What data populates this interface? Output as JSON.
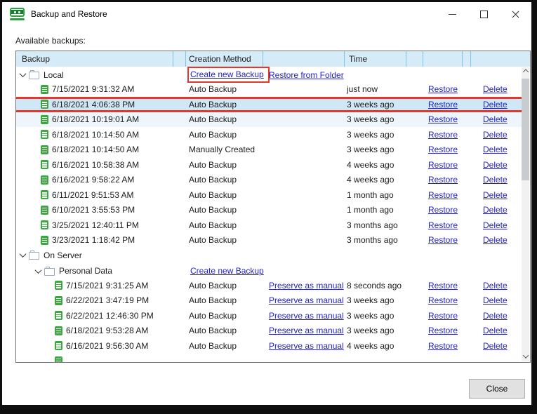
{
  "window": {
    "title": "Backup and Restore",
    "controls": {
      "minimize": "minimize",
      "maximize": "maximize",
      "close": "close"
    }
  },
  "label_available": "Available backups:",
  "close_button": "Close",
  "colors": {
    "header_bg": "#d6ebf8",
    "header_separator": "#7cc5e5",
    "selected_row": "#cfe7f7",
    "tinted_row": "#eef6fc",
    "annotation_red": "#e0392b",
    "link_blue": "#2222cc",
    "app_icon_green": "#2f9e3f",
    "backup_icon_green": "#3aa83f"
  },
  "table": {
    "headers": {
      "backup": "Backup",
      "creation_method": "Creation Method",
      "time": "Time"
    },
    "links": {
      "create_new_backup": "Create new Backup",
      "restore_from_folder": "Restore from Folder",
      "preserve_as_manual": "Preserve as manual",
      "restore": "Restore",
      "delete": "Delete"
    },
    "rows": [
      {
        "kind": "folder",
        "level": 0,
        "label": "Local",
        "actions": {
          "create_new": true,
          "create_new_annotated": true,
          "restore_from_folder": true
        }
      },
      {
        "kind": "backup",
        "level": 1,
        "date": "7/15/2021 9:31:32 AM",
        "method": "Auto Backup",
        "time": "just now"
      },
      {
        "kind": "backup",
        "level": 1,
        "date": "6/18/2021 4:06:38 PM",
        "method": "Auto Backup",
        "time": "3 weeks ago",
        "selected": true,
        "annotated": true
      },
      {
        "kind": "backup",
        "level": 1,
        "date": "6/18/2021 10:19:01 AM",
        "method": "Auto Backup",
        "time": "3 weeks ago",
        "tinted": true
      },
      {
        "kind": "backup",
        "level": 1,
        "date": "6/18/2021 10:14:50 AM",
        "method": "Auto Backup",
        "time": "3 weeks ago"
      },
      {
        "kind": "backup",
        "level": 1,
        "date": "6/18/2021 10:14:50 AM",
        "method": "Manually Created",
        "time": "3 weeks ago"
      },
      {
        "kind": "backup",
        "level": 1,
        "date": "6/16/2021 10:58:38 AM",
        "method": "Auto Backup",
        "time": "4 weeks ago"
      },
      {
        "kind": "backup",
        "level": 1,
        "date": "6/16/2021 9:58:22 AM",
        "method": "Auto Backup",
        "time": "4 weeks ago"
      },
      {
        "kind": "backup",
        "level": 1,
        "date": "6/11/2021 9:51:53 AM",
        "method": "Auto Backup",
        "time": "1 month ago"
      },
      {
        "kind": "backup",
        "level": 1,
        "date": "6/10/2021 3:55:53 PM",
        "method": "Auto Backup",
        "time": "1 month ago"
      },
      {
        "kind": "backup",
        "level": 1,
        "date": "3/25/2021 12:40:11 PM",
        "method": "Auto Backup",
        "time": "3 months ago"
      },
      {
        "kind": "backup",
        "level": 1,
        "date": "3/23/2021 1:18:42 PM",
        "method": "Auto Backup",
        "time": "3 months ago"
      },
      {
        "kind": "folder",
        "level": 0,
        "label": "On Server"
      },
      {
        "kind": "folder",
        "level": 1,
        "label": "Personal Data",
        "actions": {
          "create_new": true
        }
      },
      {
        "kind": "backup",
        "level": 2,
        "date": "7/15/2021 9:31:25 AM",
        "method": "Auto Backup",
        "preserve": true,
        "time": "8 seconds ago"
      },
      {
        "kind": "backup",
        "level": 2,
        "date": "6/22/2021 3:47:19 PM",
        "method": "Auto Backup",
        "preserve": true,
        "time": "3 weeks ago"
      },
      {
        "kind": "backup",
        "level": 2,
        "date": "6/22/2021 12:46:30 PM",
        "method": "Auto Backup",
        "preserve": true,
        "time": "3 weeks ago"
      },
      {
        "kind": "backup",
        "level": 2,
        "date": "6/18/2021 9:53:28 AM",
        "method": "Auto Backup",
        "preserve": true,
        "time": "3 weeks ago"
      },
      {
        "kind": "backup",
        "level": 2,
        "date": "6/16/2021 9:56:30 AM",
        "method": "Auto Backup",
        "preserve": true,
        "time": "4 weeks ago"
      },
      {
        "kind": "backup",
        "level": 2,
        "partial": true
      }
    ]
  }
}
